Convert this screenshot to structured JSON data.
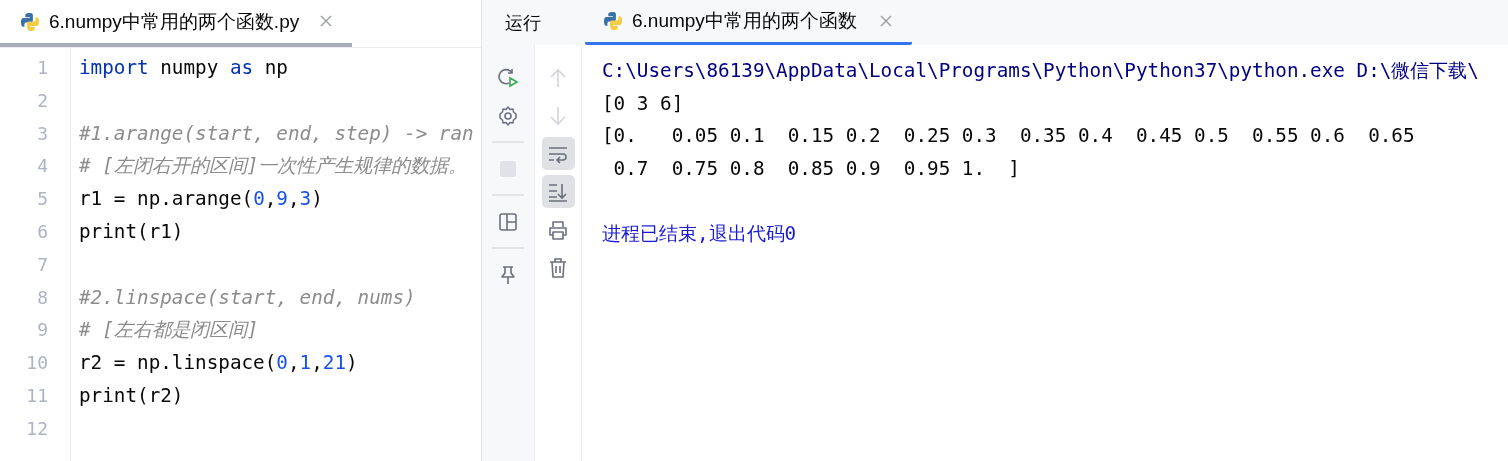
{
  "editor": {
    "tabs": [
      {
        "label": "6.numpy中常用的两个函数.py",
        "selected": true
      }
    ],
    "lines": [
      {
        "number": "1",
        "tokens": [
          {
            "kind": "keyword",
            "text": "import"
          },
          {
            "kind": "plain",
            "text": " numpy "
          },
          {
            "kind": "keyword",
            "text": "as"
          },
          {
            "kind": "plain",
            "text": " np"
          }
        ]
      },
      {
        "number": "2"
      },
      {
        "number": "3",
        "tokens": [
          {
            "kind": "comment",
            "text": "#1.arange(start, end, step) -> ran"
          }
        ]
      },
      {
        "number": "4",
        "tokens": [
          {
            "kind": "comment",
            "text": "# [左闭右开的区间]一次性产生规律的数据。"
          }
        ]
      },
      {
        "number": "5",
        "tokens": [
          {
            "kind": "plain",
            "text": "r1 = np.arange("
          },
          {
            "kind": "number",
            "text": "0"
          },
          {
            "kind": "plain",
            "text": ","
          },
          {
            "kind": "number",
            "text": "9"
          },
          {
            "kind": "plain",
            "text": ","
          },
          {
            "kind": "number",
            "text": "3"
          },
          {
            "kind": "plain",
            "text": ")"
          }
        ]
      },
      {
        "number": "6",
        "tokens": [
          {
            "kind": "plain",
            "text": "print(r1)"
          }
        ]
      },
      {
        "number": "7"
      },
      {
        "number": "8",
        "tokens": [
          {
            "kind": "comment",
            "text": "#2.linspace(start, end, nums)"
          }
        ]
      },
      {
        "number": "9",
        "tokens": [
          {
            "kind": "comment",
            "text": "# [左右都是闭区间]"
          }
        ]
      },
      {
        "number": "10",
        "tokens": [
          {
            "kind": "plain",
            "text": "r2 = np.linspace("
          },
          {
            "kind": "number",
            "text": "0"
          },
          {
            "kind": "plain",
            "text": ","
          },
          {
            "kind": "number",
            "text": "1"
          },
          {
            "kind": "plain",
            "text": ","
          },
          {
            "kind": "number",
            "text": "21"
          },
          {
            "kind": "plain",
            "text": ")"
          }
        ]
      },
      {
        "number": "11",
        "tokens": [
          {
            "kind": "plain",
            "text": "print(r2)"
          }
        ]
      },
      {
        "number": "12"
      }
    ]
  },
  "run_panel": {
    "title": "运行",
    "tabs": [
      {
        "label": "6.numpy中常用的两个函数",
        "selected": true
      }
    ],
    "toolbar": [
      {
        "kind": "rerun",
        "on": false,
        "disabled": false
      },
      {
        "kind": "settings",
        "on": false,
        "disabled": false
      },
      {
        "kind": "stop",
        "on": false,
        "disabled": true
      },
      {
        "kind": "layout",
        "on": false,
        "disabled": false
      },
      {
        "kind": "pin",
        "on": false,
        "disabled": false
      }
    ],
    "side_toolbar": [
      {
        "kind": "up",
        "on": false,
        "disabled": true
      },
      {
        "kind": "down",
        "on": false,
        "disabled": true
      },
      {
        "kind": "wrap",
        "on": true,
        "disabled": false
      },
      {
        "kind": "scroll-end",
        "on": true,
        "disabled": false
      },
      {
        "kind": "print",
        "on": false,
        "disabled": false
      },
      {
        "kind": "trash",
        "on": false,
        "disabled": false
      }
    ],
    "console": [
      {
        "kind": "command",
        "text": "C:\\Users\\86139\\AppData\\Local\\Programs\\Python\\Python37\\python.exe D:\\微信下载\\"
      },
      {
        "kind": "output",
        "text": "[0 3 6]"
      },
      {
        "kind": "output",
        "text": "[0.   0.05 0.1  0.15 0.2  0.25 0.3  0.35 0.4  0.45 0.5  0.55 0.6  0.65"
      },
      {
        "kind": "output",
        "text": " 0.7  0.75 0.8  0.85 0.9  0.95 1.  ]"
      },
      {
        "kind": "blank"
      },
      {
        "kind": "system",
        "text": "进程已结束,退出代码0"
      }
    ]
  }
}
